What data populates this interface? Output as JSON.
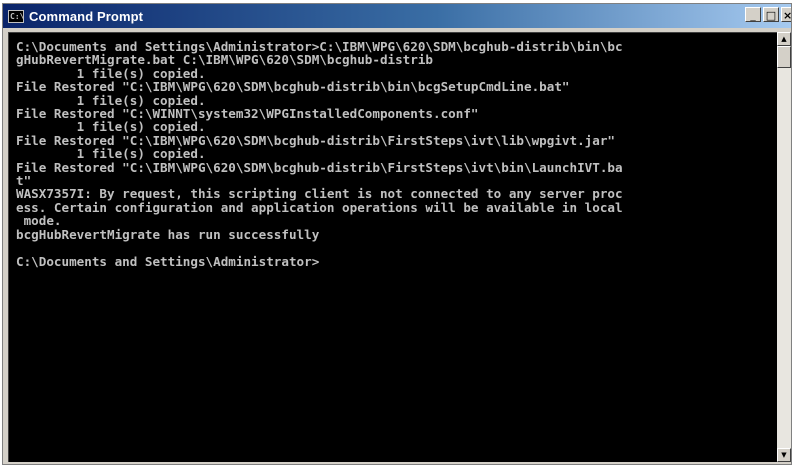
{
  "window": {
    "title": "Command Prompt",
    "icon_text": "C:\\",
    "controls": {
      "minimize": "_",
      "maximize": "□",
      "close": "×"
    }
  },
  "console": {
    "lines": [
      "C:\\Documents and Settings\\Administrator>C:\\IBM\\WPG\\620\\SDM\\bcghub-distrib\\bin\\bc",
      "gHubRevertMigrate.bat C:\\IBM\\WPG\\620\\SDM\\bcghub-distrib",
      "        1 file(s) copied.",
      "File Restored \"C:\\IBM\\WPG\\620\\SDM\\bcghub-distrib\\bin\\bcgSetupCmdLine.bat\"",
      "        1 file(s) copied.",
      "File Restored \"C:\\WINNT\\system32\\WPGInstalledComponents.conf\"",
      "        1 file(s) copied.",
      "File Restored \"C:\\IBM\\WPG\\620\\SDM\\bcghub-distrib\\FirstSteps\\ivt\\lib\\wpgivt.jar\"",
      "        1 file(s) copied.",
      "File Restored \"C:\\IBM\\WPG\\620\\SDM\\bcghub-distrib\\FirstSteps\\ivt\\bin\\LaunchIVT.ba",
      "t\"",
      "WASX7357I: By request, this scripting client is not connected to any server proc",
      "ess. Certain configuration and application operations will be available in local",
      " mode.",
      "bcgHubRevertMigrate has run successfully",
      "",
      "C:\\Documents and Settings\\Administrator>"
    ]
  },
  "scrollbar": {
    "up_arrow": "▲",
    "down_arrow": "▼"
  },
  "colors": {
    "console_bg": "#000000",
    "console_text": "#c0c0c0",
    "titlebar": "#0a246a"
  }
}
